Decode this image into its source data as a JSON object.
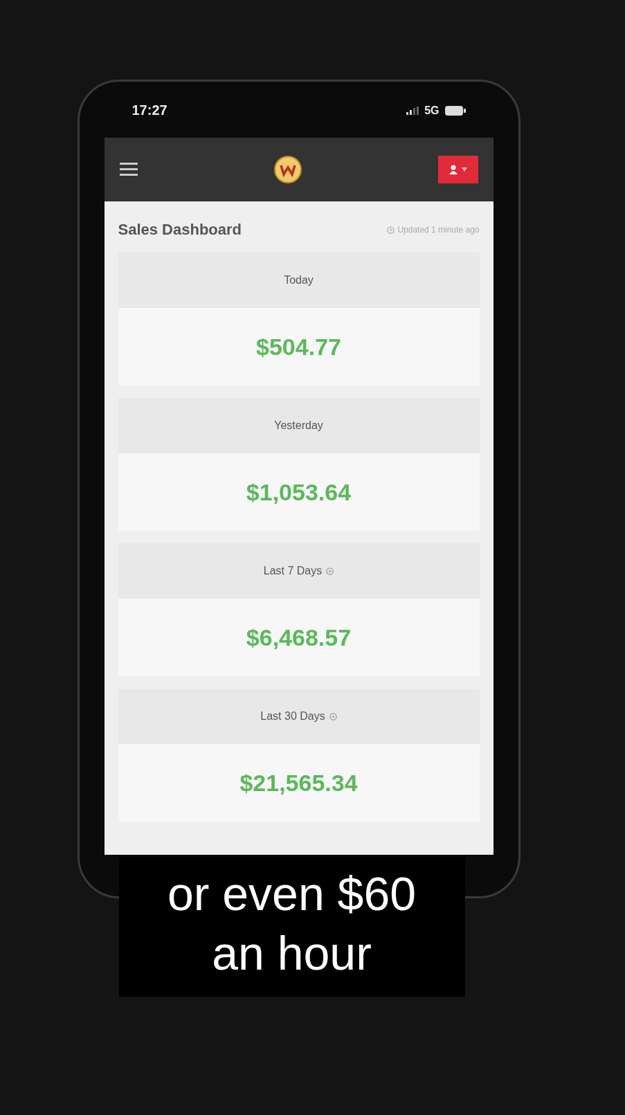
{
  "status_bar": {
    "time": "17:27",
    "network": "5G"
  },
  "header": {
    "title": "Sales Dashboard",
    "updated": "Updated 1 minute ago"
  },
  "cards": [
    {
      "label": "Today",
      "value": "$504.77",
      "info": false
    },
    {
      "label": "Yesterday",
      "value": "$1,053.64",
      "info": false
    },
    {
      "label": "Last 7 Days",
      "value": "$6,468.57",
      "info": true
    },
    {
      "label": "Last 30 Days",
      "value": "$21,565.34",
      "info": true
    }
  ],
  "caption": [
    "or even $60",
    "an hour"
  ]
}
